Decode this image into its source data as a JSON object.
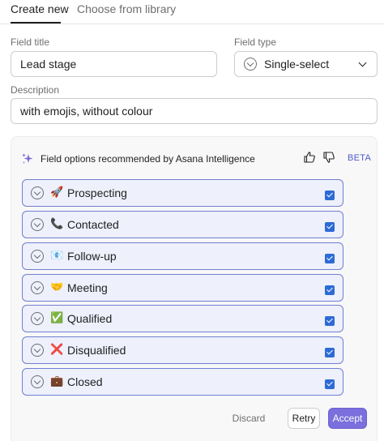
{
  "tabs": [
    {
      "label": "Create new",
      "active": true
    },
    {
      "label": "Choose from library",
      "active": false
    }
  ],
  "form": {
    "field_title_label": "Field title",
    "field_title_value": "Lead stage",
    "field_type_label": "Field type",
    "field_type_value": "Single-select",
    "description_label": "Description",
    "description_value": "with emojis, without colour"
  },
  "ai": {
    "header": "Field options recommended by Asana Intelligence",
    "badge": "BETA",
    "options": [
      {
        "emoji": "🚀",
        "label": "Prospecting",
        "checked": true
      },
      {
        "emoji": "📞",
        "label": "Contacted",
        "checked": true
      },
      {
        "emoji": "📧",
        "label": "Follow-up",
        "checked": true
      },
      {
        "emoji": "🤝",
        "label": "Meeting",
        "checked": true
      },
      {
        "emoji": "✅",
        "label": "Qualified",
        "checked": true
      },
      {
        "emoji": "❌",
        "label": "Disqualified",
        "checked": true
      },
      {
        "emoji": "💼",
        "label": "Closed",
        "checked": true
      }
    ],
    "buttons": {
      "discard": "Discard",
      "retry": "Retry",
      "accept": "Accept"
    }
  },
  "colors": {
    "accent": "#7a6fdc",
    "option_border": "#6f7fd4",
    "option_bg": "#eef0fb",
    "checkbox": "#2d6bd6",
    "beta": "#4a5bc7"
  },
  "icons": [
    "sparkle-icon",
    "thumbs-up-icon",
    "thumbs-down-icon",
    "chevron-down-icon",
    "select-type-icon",
    "checkbox-icon"
  ]
}
